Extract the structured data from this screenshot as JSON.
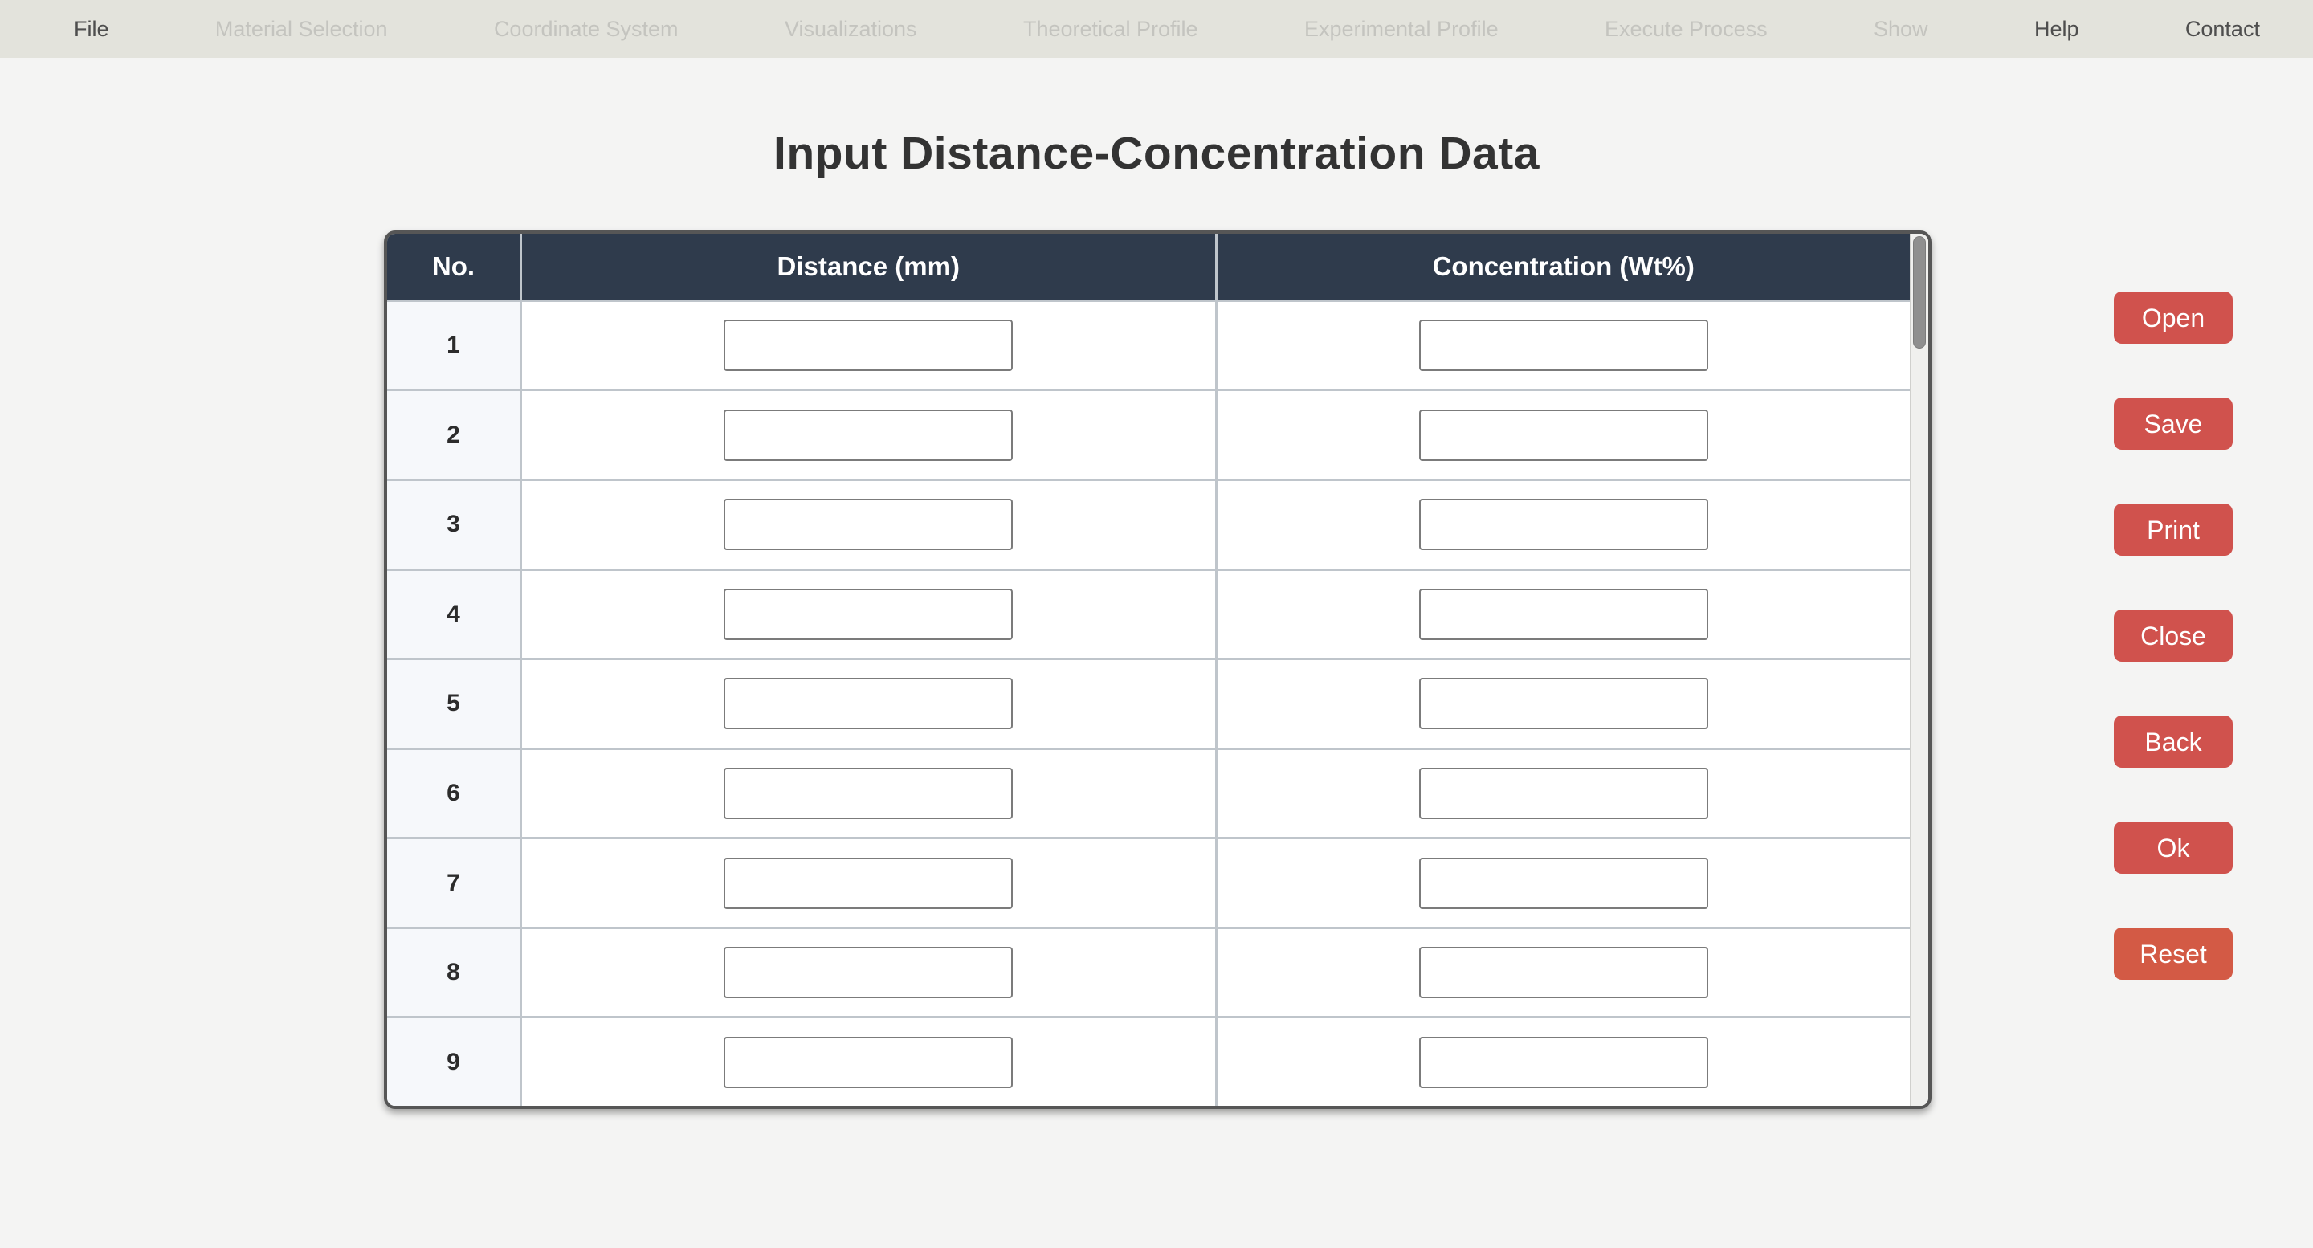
{
  "menubar": {
    "items": [
      {
        "label": "File",
        "enabled": true
      },
      {
        "label": "Material Selection",
        "enabled": false
      },
      {
        "label": "Coordinate System",
        "enabled": false
      },
      {
        "label": "Visualizations",
        "enabled": false
      },
      {
        "label": "Theoretical Profile",
        "enabled": false
      },
      {
        "label": "Experimental Profile",
        "enabled": false
      },
      {
        "label": "Execute Process",
        "enabled": false
      },
      {
        "label": "Show",
        "enabled": false
      },
      {
        "label": "Help",
        "enabled": true
      },
      {
        "label": "Contact",
        "enabled": true
      }
    ]
  },
  "page": {
    "title": "Input Distance-Concentration Data"
  },
  "table": {
    "headers": {
      "no": "No.",
      "distance": "Distance (mm)",
      "concentration": "Concentration (Wt%)"
    },
    "rows": [
      {
        "no": "1",
        "distance": "",
        "concentration": ""
      },
      {
        "no": "2",
        "distance": "",
        "concentration": ""
      },
      {
        "no": "3",
        "distance": "",
        "concentration": ""
      },
      {
        "no": "4",
        "distance": "",
        "concentration": ""
      },
      {
        "no": "5",
        "distance": "",
        "concentration": ""
      },
      {
        "no": "6",
        "distance": "",
        "concentration": ""
      },
      {
        "no": "7",
        "distance": "",
        "concentration": ""
      },
      {
        "no": "8",
        "distance": "",
        "concentration": ""
      },
      {
        "no": "9",
        "distance": "",
        "concentration": ""
      }
    ]
  },
  "actions": {
    "open": "Open",
    "save": "Save",
    "print": "Print",
    "close": "Close",
    "back": "Back",
    "ok": "Ok",
    "reset": "Reset"
  },
  "colors": {
    "menubar_bg": "#e3e3dc",
    "page_bg": "#f4f4f3",
    "table_header_bg": "#2f3b4c",
    "row_label_bg": "#f6f8fb",
    "grid_line": "#bfc5cb",
    "button": "#d0524d",
    "reset_button": "#d35a45",
    "scrollbar_thumb": "#8f8f8f"
  }
}
